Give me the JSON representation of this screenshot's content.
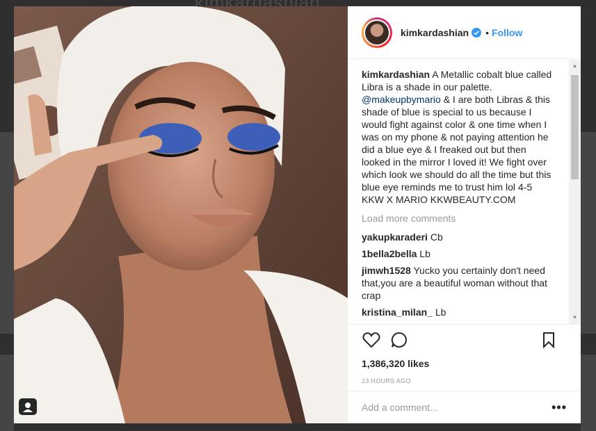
{
  "background": {
    "title": "kimkardashian"
  },
  "post": {
    "username": "kimkardashian",
    "follow_label": "Follow",
    "separator": "•",
    "caption_user": "kimkardashian",
    "caption_part1": "A Metallic cobalt blue called Libra is a shade in our palette.",
    "caption_mention": "@makeupbymario",
    "caption_part2": "& I are both Libras & this shade of blue is special to us because I would fight against color & one time when I was on my phone & not paying attention he did a blue eye & I freaked out but then looked in the mirror I loved it! We fight over which look we should do all the time but this blue eye reminds me to trust him lol 4-5 KKW X MARIO KKWBEAUTY.COM",
    "load_more": "Load more comments",
    "comments": [
      {
        "user": "yakupkaraderi",
        "text": "Cb"
      },
      {
        "user": "1bella2bella",
        "text": "Lb"
      },
      {
        "user": "jimwh1528",
        "text": "Yucko you certainly don't need that,you are a beautiful woman without that crap"
      },
      {
        "user": "kristina_milan_",
        "text": "Lb"
      }
    ],
    "likes": "1,386,320 likes",
    "time": "23 HOURS AGO",
    "add_comment_placeholder": "Add a comment...",
    "more_label": "•••"
  },
  "icons": {
    "like": "heart-icon",
    "comment": "comment-icon",
    "save": "bookmark-icon",
    "verified": "verified-badge-icon",
    "profile_photo_tag": "user-tag-icon"
  },
  "colors": {
    "follow_blue": "#3897f0",
    "mention_blue": "#003569",
    "text": "#262626",
    "muted": "#999999"
  }
}
